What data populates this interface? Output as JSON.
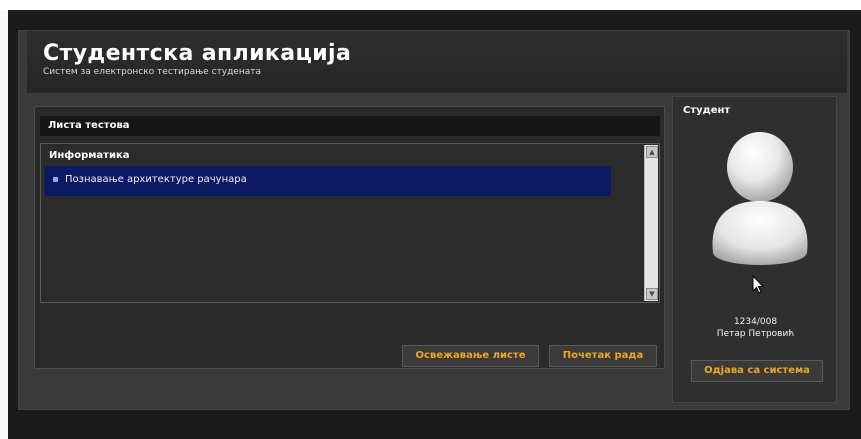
{
  "header": {
    "title": "Студентска апликација",
    "subtitle": "Систем за електронско тестирање студената"
  },
  "tests_panel": {
    "title": "Листа тестова",
    "category": "Информатика",
    "items": [
      {
        "label": "Познавање архитектуре рачунара",
        "selected": true
      }
    ],
    "scroll_up_icon": "triangle-up",
    "scroll_down_icon": "triangle-down",
    "refresh_label": "Освежавање листе",
    "start_label": "Почетак рада"
  },
  "student_panel": {
    "title": "Студент",
    "avatar_icon": "user-silhouette",
    "student_id": "1234/008",
    "student_name": "Петар Петровић",
    "logout_label": "Одјава са система"
  },
  "colors": {
    "accent_button_text": "#f0a71b",
    "selection_bg": "#0b1a63",
    "panel_bg": "#2a2a2a",
    "frame_bg": "#3a3a3a",
    "shell_bg": "#1b1b1b"
  }
}
